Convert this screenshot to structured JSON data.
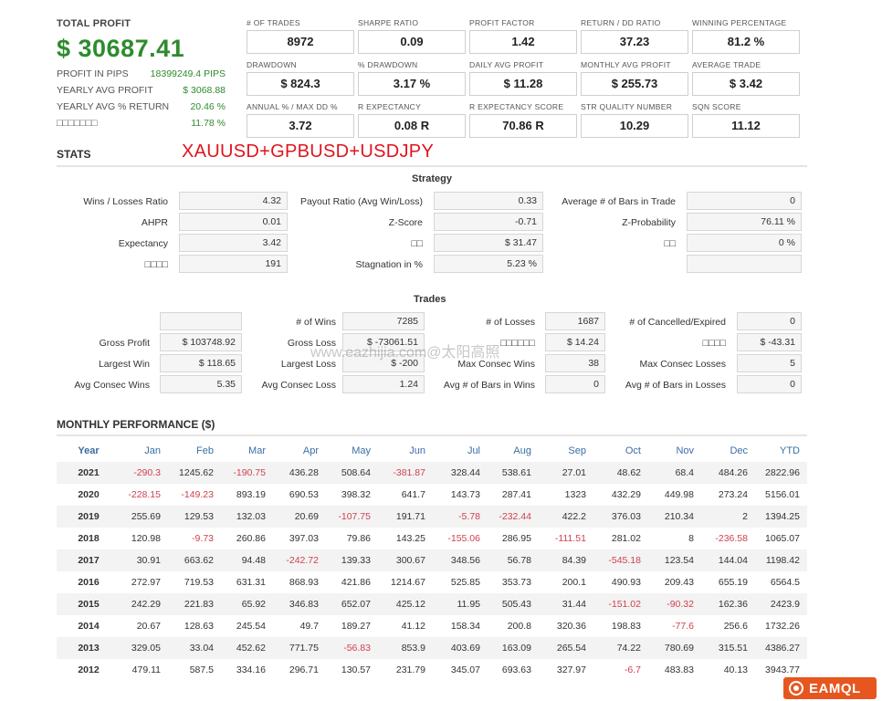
{
  "summary": {
    "total_profit_label": "TOTAL PROFIT",
    "total_profit_value": "$ 30687.41",
    "items": [
      {
        "label": "PROFIT IN PIPS",
        "value": "18399249.4 PIPS"
      },
      {
        "label": "YEARLY AVG PROFIT",
        "value": "$ 3068.88"
      },
      {
        "label": "YEARLY AVG % RETURN",
        "value": "20.46 %"
      },
      {
        "label": "□□□□□□□",
        "value": "11.78 %"
      }
    ]
  },
  "metrics": [
    {
      "label": "# OF TRADES",
      "value": "8972"
    },
    {
      "label": "SHARPE RATIO",
      "value": "0.09"
    },
    {
      "label": "PROFIT FACTOR",
      "value": "1.42"
    },
    {
      "label": "RETURN / DD RATIO",
      "value": "37.23"
    },
    {
      "label": "WINNING PERCENTAGE",
      "value": "81.2 %"
    },
    {
      "label": "DRAWDOWN",
      "value": "$ 824.3"
    },
    {
      "label": "% DRAWDOWN",
      "value": "3.17 %"
    },
    {
      "label": "DAILY AVG PROFIT",
      "value": "$ 11.28"
    },
    {
      "label": "MONTHLY AVG PROFIT",
      "value": "$ 255.73"
    },
    {
      "label": "AVERAGE TRADE",
      "value": "$ 3.42"
    },
    {
      "label": "ANNUAL % / MAX DD %",
      "value": "3.72"
    },
    {
      "label": "R EXPECTANCY",
      "value": "0.08 R"
    },
    {
      "label": "R EXPECTANCY SCORE",
      "value": "70.86 R"
    },
    {
      "label": "STR QUALITY NUMBER",
      "value": "10.29"
    },
    {
      "label": "SQN SCORE",
      "value": "11.12"
    }
  ],
  "stats": {
    "title": "STATS",
    "pair": "XAUUSD+GPBUSD+USDJPY",
    "strategy_title": "Strategy",
    "strategy": [
      {
        "label": "Wins / Losses Ratio",
        "value": "4.32"
      },
      {
        "label": "Payout Ratio (Avg Win/Loss)",
        "value": "0.33"
      },
      {
        "label": "Average # of Bars in Trade",
        "value": "0"
      },
      {
        "label": "AHPR",
        "value": "0.01"
      },
      {
        "label": "Z-Score",
        "value": "-0.71"
      },
      {
        "label": "Z-Probability",
        "value": "76.11 %"
      },
      {
        "label": "Expectancy",
        "value": "3.42"
      },
      {
        "label": "□□",
        "value": "$ 31.47"
      },
      {
        "label": "□□",
        "value": "0 %"
      },
      {
        "label": "□□□□",
        "value": "191"
      },
      {
        "label": "Stagnation in %",
        "value": "5.23 %"
      },
      {
        "label": "",
        "value": ""
      }
    ],
    "trades_title": "Trades",
    "trades": [
      {
        "label": "",
        "value": ""
      },
      {
        "label": "# of Wins",
        "value": "7285"
      },
      {
        "label": "# of Losses",
        "value": "1687"
      },
      {
        "label": "# of Cancelled/Expired",
        "value": "0"
      },
      {
        "label": "Gross Profit",
        "value": "$ 103748.92"
      },
      {
        "label": "Gross Loss",
        "value": "$ -73061.51"
      },
      {
        "label": "□□□□□□",
        "value": "$ 14.24"
      },
      {
        "label": "□□□□",
        "value": "$ -43.31"
      },
      {
        "label": "Largest Win",
        "value": "$ 118.65"
      },
      {
        "label": "Largest Loss",
        "value": "$ -200"
      },
      {
        "label": "Max Consec Wins",
        "value": "38"
      },
      {
        "label": "Max Consec Losses",
        "value": "5"
      },
      {
        "label": "Avg Consec Wins",
        "value": "5.35"
      },
      {
        "label": "Avg Consec Loss",
        "value": "1.24"
      },
      {
        "label": "Avg # of Bars in Wins",
        "value": "0"
      },
      {
        "label": "Avg # of Bars in Losses",
        "value": "0"
      }
    ]
  },
  "watermark": "www.eazhijia.com@太阳高照",
  "monthly": {
    "title": "MONTHLY PERFORMANCE ($)",
    "headers": [
      "Year",
      "Jan",
      "Feb",
      "Mar",
      "Apr",
      "May",
      "Jun",
      "Jul",
      "Aug",
      "Sep",
      "Oct",
      "Nov",
      "Dec",
      "YTD"
    ],
    "rows": [
      [
        "2021",
        "-290.3",
        "1245.62",
        "-190.75",
        "436.28",
        "508.64",
        "-381.87",
        "328.44",
        "538.61",
        "27.01",
        "48.62",
        "68.4",
        "484.26",
        "2822.96"
      ],
      [
        "2020",
        "-228.15",
        "-149.23",
        "893.19",
        "690.53",
        "398.32",
        "641.7",
        "143.73",
        "287.41",
        "1323",
        "432.29",
        "449.98",
        "273.24",
        "5156.01"
      ],
      [
        "2019",
        "255.69",
        "129.53",
        "132.03",
        "20.69",
        "-107.75",
        "191.71",
        "-5.78",
        "-232.44",
        "422.2",
        "376.03",
        "210.34",
        "2",
        "1394.25"
      ],
      [
        "2018",
        "120.98",
        "-9.73",
        "260.86",
        "397.03",
        "79.86",
        "143.25",
        "-155.06",
        "286.95",
        "-111.51",
        "281.02",
        "8",
        "-236.58",
        "1065.07"
      ],
      [
        "2017",
        "30.91",
        "663.62",
        "94.48",
        "-242.72",
        "139.33",
        "300.67",
        "348.56",
        "56.78",
        "84.39",
        "-545.18",
        "123.54",
        "144.04",
        "1198.42"
      ],
      [
        "2016",
        "272.97",
        "719.53",
        "631.31",
        "868.93",
        "421.86",
        "1214.67",
        "525.85",
        "353.73",
        "200.1",
        "490.93",
        "209.43",
        "655.19",
        "6564.5"
      ],
      [
        "2015",
        "242.29",
        "221.83",
        "65.92",
        "346.83",
        "652.07",
        "425.12",
        "11.95",
        "505.43",
        "31.44",
        "-151.02",
        "-90.32",
        "162.36",
        "2423.9"
      ],
      [
        "2014",
        "20.67",
        "128.63",
        "245.54",
        "49.7",
        "189.27",
        "41.12",
        "158.34",
        "200.8",
        "320.36",
        "198.83",
        "-77.6",
        "256.6",
        "1732.26"
      ],
      [
        "2013",
        "329.05",
        "33.04",
        "452.62",
        "771.75",
        "-56.83",
        "853.9",
        "403.69",
        "163.09",
        "265.54",
        "74.22",
        "780.69",
        "315.51",
        "4386.27"
      ],
      [
        "2012",
        "479.11",
        "587.5",
        "334.16",
        "296.71",
        "130.57",
        "231.79",
        "345.07",
        "693.63",
        "327.97",
        "-6.7",
        "483.83",
        "40.13",
        "3943.77"
      ]
    ]
  },
  "logo": {
    "text": "EAMQL",
    "icon": "eamql-logo-icon",
    "color": "#e7561f"
  },
  "colors": {
    "positive": "#2e8b2e",
    "negative": "#d0404f",
    "header": "#3a6ea5",
    "pair": "#e0141e"
  }
}
